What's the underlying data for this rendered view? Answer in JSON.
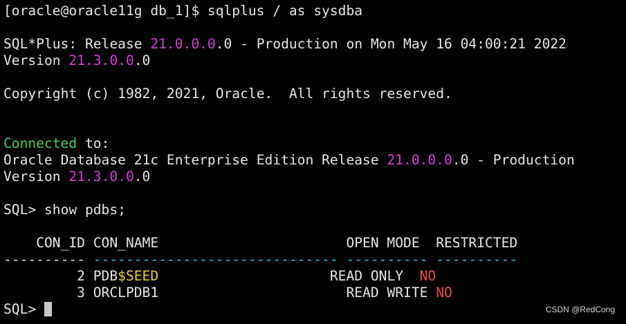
{
  "terminal": {
    "prompt_line": "[oracle@oracle11g db_1]$ sqlplus / as sysdba",
    "banner": {
      "release_prefix": "SQL*Plus: Release ",
      "release_version_hl": "21.0.0.0",
      "release_version_tail": ".0 - Production on Mon May 16 04:00:21 2022",
      "version_prefix": "Version ",
      "version_hl": "21.3.0.0",
      "version_tail": ".0"
    },
    "copyright": "Copyright (c) 1982, 2021, Oracle.  All rights reserved.",
    "connected": {
      "word": "Connected",
      "rest": " to:"
    },
    "db_release": {
      "prefix": "Oracle Database 21c Enterprise Edition Release ",
      "version_hl": "21.0.0.0",
      "tail": ".0 - Production"
    },
    "db_version": {
      "prefix": "Version ",
      "version_hl": "21.3.0.0",
      "tail": ".0"
    },
    "command_line": "SQL> show pdbs;",
    "table": {
      "header": "    CON_ID CON_NAME                       OPEN MODE  RESTRICTED",
      "sep_first": "----------",
      "sep_rest": " ------------------------------ ---------- ----------",
      "rows": [
        {
          "con_id_padded": "         2 ",
          "name_plain": "PDB",
          "name_hl": "$SEED",
          "name_pad": "                    ",
          "open_mode": " READ ONLY  ",
          "restricted": "NO"
        },
        {
          "con_id_padded": "         3 ",
          "name_plain": "ORCLPDB1",
          "name_hl": "",
          "name_pad": "                      ",
          "open_mode": " READ WRITE ",
          "restricted": "NO"
        }
      ]
    },
    "final_prompt": "SQL> "
  },
  "watermark": "CSDN @RedCong",
  "colors": {
    "background": "#000000",
    "text": "#e6e6e6",
    "version_highlight": "#d33fd3",
    "connected": "#3fcf5f",
    "seed_highlight": "#e8d13a",
    "restricted_no": "#ea4a4a",
    "separator": "#27c5d8"
  }
}
